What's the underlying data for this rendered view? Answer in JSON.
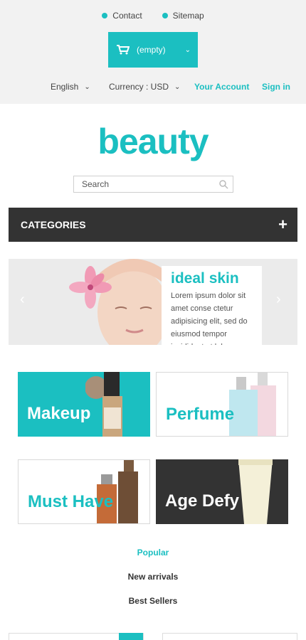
{
  "header": {
    "links": [
      {
        "label": "Contact"
      },
      {
        "label": "Sitemap"
      }
    ],
    "cart": {
      "label": "(empty)"
    },
    "settings": {
      "language": "English",
      "currency": "Currency : USD",
      "account": "Your Account",
      "signin": "Sign in"
    }
  },
  "logo": "beauty",
  "search": {
    "placeholder": "Search"
  },
  "categories": {
    "label": "CATEGORIES",
    "toggle": "+"
  },
  "slider": {
    "title": "ideal skin",
    "text": "Lorem ipsum dolor sit amet conse ctetur adipisicing elit, sed do eiusmod tempor incididunt ut labore"
  },
  "banners": [
    {
      "label": "Makeup"
    },
    {
      "label": "Perfume"
    },
    {
      "label": "Must Have"
    },
    {
      "label": "Age Defy"
    }
  ],
  "tabs": [
    {
      "label": "Popular"
    },
    {
      "label": "New arrivals"
    },
    {
      "label": "Best Sellers"
    }
  ],
  "colors": {
    "accent": "#1bbfc1",
    "dark": "#333333"
  }
}
